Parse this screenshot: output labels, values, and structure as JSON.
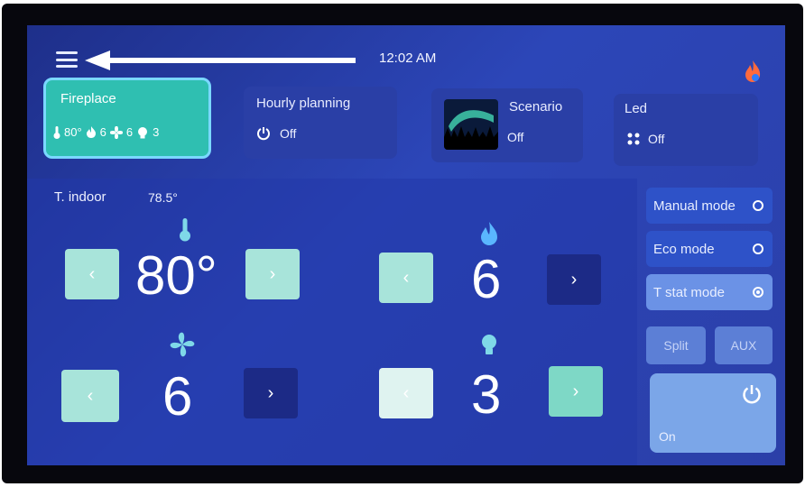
{
  "header": {
    "time": "12:02 AM",
    "menu_icon": "hamburger-menu-icon",
    "flame_icon": "flame-icon"
  },
  "cards": {
    "fireplace": {
      "title": "Fireplace",
      "temp": "80°",
      "flame": "6",
      "fan": "6",
      "light": "3"
    },
    "hourly": {
      "title": "Hourly planning",
      "value": "Off"
    },
    "scenario": {
      "title": "Scenario",
      "value": "Off"
    },
    "led": {
      "title": "Led",
      "value": "Off"
    }
  },
  "indoor": {
    "label": "T. indoor",
    "value": "78.5°"
  },
  "controls": {
    "temperature": {
      "value": "80°"
    },
    "flame": {
      "value": "6"
    },
    "fan": {
      "value": "6"
    },
    "light": {
      "value": "3"
    },
    "prev_glyph": "‹",
    "next_glyph": "›"
  },
  "modes": {
    "manual": "Manual mode",
    "eco": "Eco mode",
    "tstat": "T stat mode",
    "split": "Split",
    "aux": "AUX"
  },
  "power": {
    "label": "On"
  },
  "colors": {
    "background": "#2c46b8",
    "fireplace_card": "#2fbfb1",
    "active_mode": "#6b92e6"
  }
}
